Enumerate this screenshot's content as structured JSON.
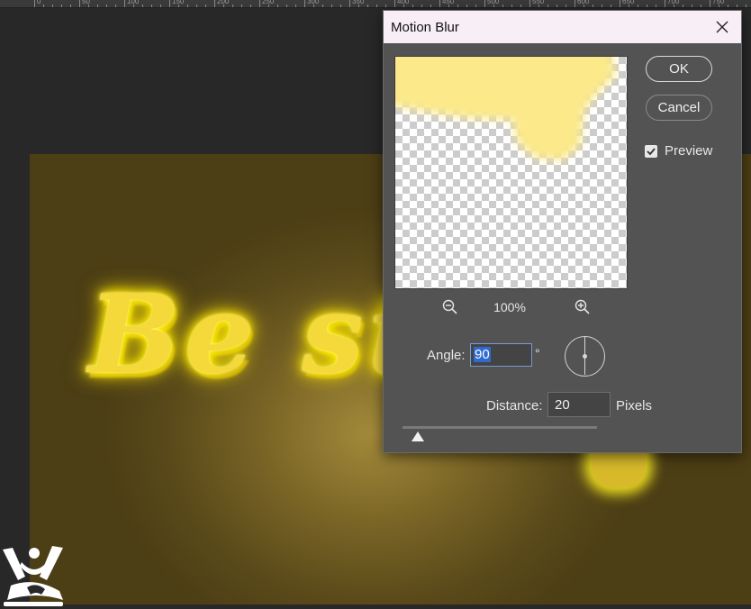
{
  "ruler": {
    "numbers": [
      "0",
      "50",
      "100",
      "150",
      "200",
      "250",
      "300",
      "350",
      "400",
      "450",
      "500",
      "550",
      "600",
      "650",
      "700",
      "750"
    ]
  },
  "canvas": {
    "text": "Be st"
  },
  "dialog": {
    "title": "Motion Blur",
    "ok_label": "OK",
    "cancel_label": "Cancel",
    "preview_label": "Preview",
    "preview_checked": true,
    "zoom_level": "100%",
    "angle_label": "Angle:",
    "angle_value": "90",
    "degree_symbol": "°",
    "distance_label": "Distance:",
    "distance_value": "20",
    "distance_unit": "Pixels",
    "distance_fraction": 0.08
  },
  "colors": {
    "dialog_bg": "#535353",
    "titlebar_bg": "#f7eef6",
    "canvas_glow": "#ffee00",
    "selection": "#2f6ad0"
  },
  "icons": {
    "zoom_out": "zoom-out-icon",
    "zoom_in": "zoom-in-icon",
    "close": "close-icon",
    "check": "check-icon"
  }
}
